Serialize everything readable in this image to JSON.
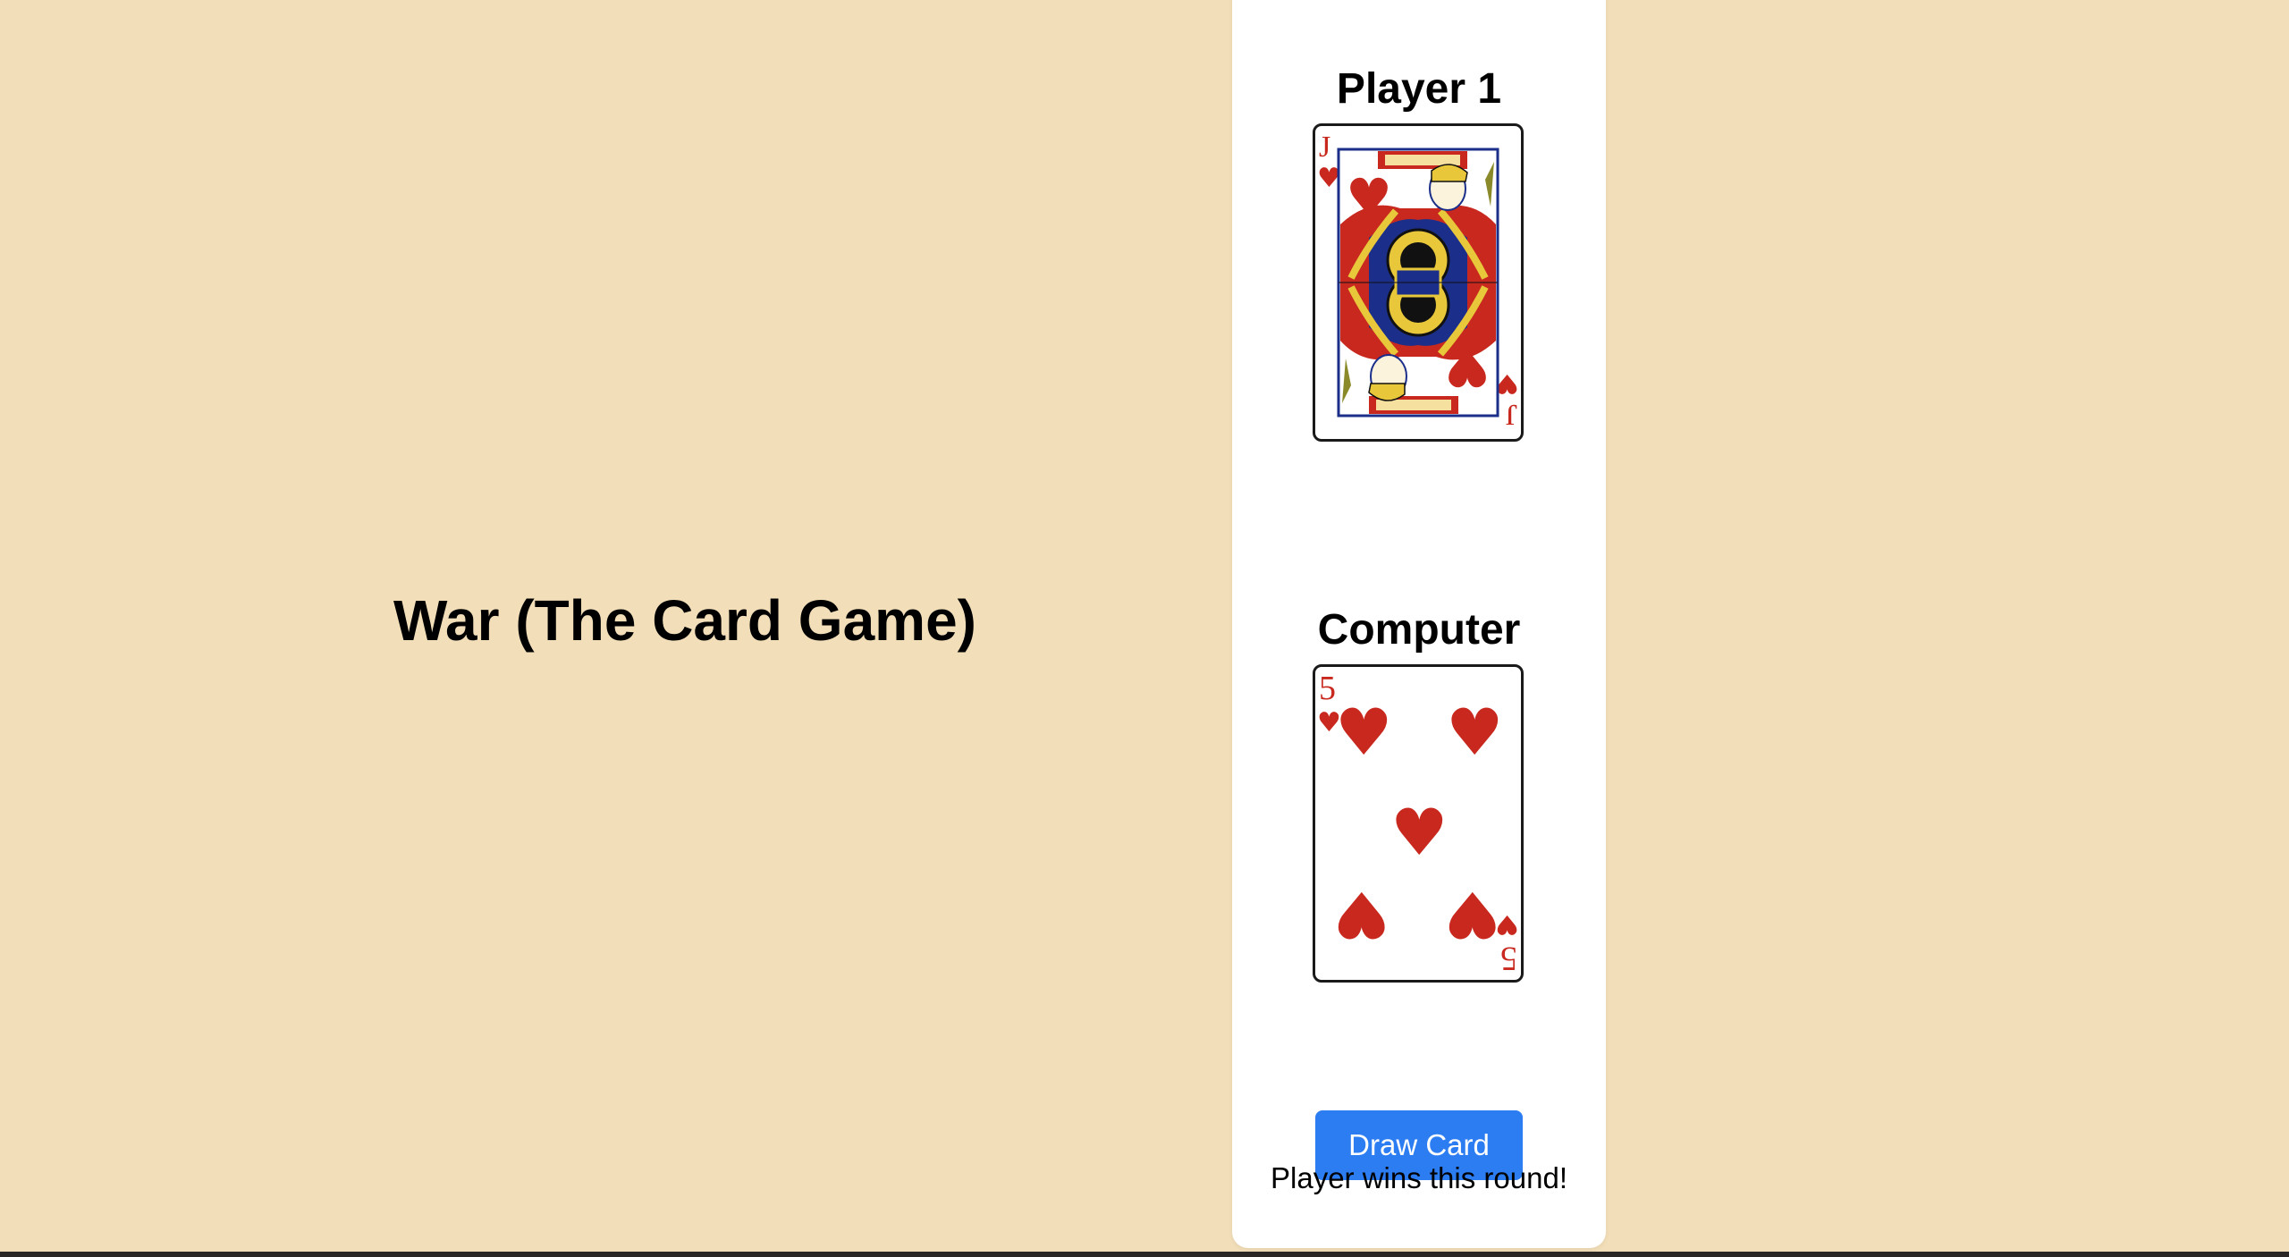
{
  "title": "War (The Card Game)",
  "player": {
    "heading": "Player 1",
    "card": {
      "rank": "J",
      "suit": "hearts",
      "suit_symbol": "♥"
    }
  },
  "computer": {
    "heading": "Computer",
    "card": {
      "rank": "5",
      "suit": "hearts",
      "suit_symbol": "♥"
    }
  },
  "controls": {
    "draw_label": "Draw Card"
  },
  "status": {
    "message": "Player wins this round!"
  },
  "colors": {
    "background": "#f2deb8",
    "panel": "#ffffff",
    "button": "#2c7cf2",
    "suit_red": "#c8281e"
  }
}
